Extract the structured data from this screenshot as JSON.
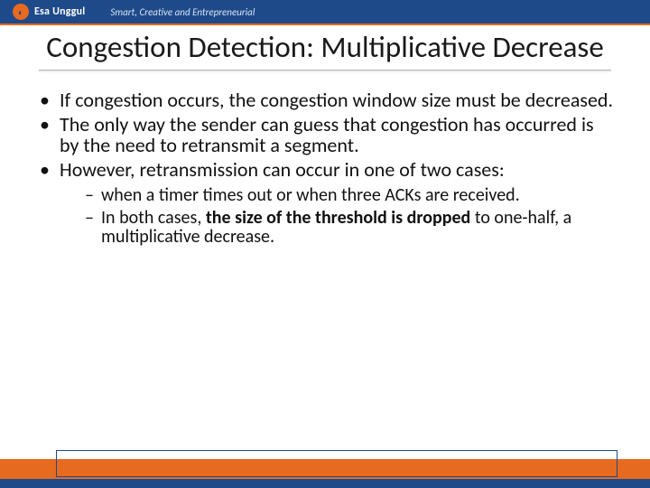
{
  "brand": {
    "logo_glyph": "◐",
    "university": "Esa Unggul",
    "tagline": "Smart, Creative and Entrepreneurial"
  },
  "slide": {
    "title": "Congestion Detection: Multiplicative Decrease",
    "bullets": [
      {
        "text": "If congestion occurs, the congestion window size must be decreased."
      },
      {
        "text": "The only way the sender can guess that congestion has occurred is by the need to retransmit a segment."
      },
      {
        "text": "However, retransmission can occur in one of two cases:",
        "sub": [
          {
            "html": "when a timer times out or when three ACKs are received."
          },
          {
            "html": "In both cases, <span class=\"bold\">the size of the threshold is dropped</span> to one-half, a multiplicative decrease."
          }
        ]
      }
    ]
  }
}
